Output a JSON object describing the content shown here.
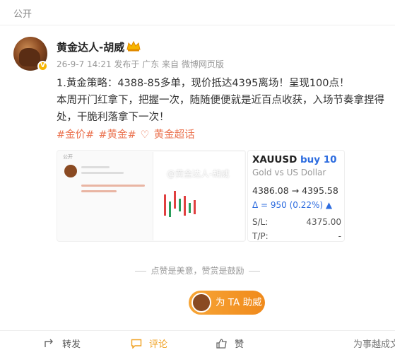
{
  "header": {
    "visibility": "公开"
  },
  "post": {
    "author": "黄金达人-胡威",
    "meta": "26-9-7 14:21  发布于 广东  来自 微博网页版",
    "lines": [
      "1.黄金策略：4388-85多单，现价抵达4395离场！呈现100点！",
      "本周开门红拿下，把握一次，随随便便就是近百点收获，入场节奏拿捏得",
      "处，干脆利落拿下一次！"
    ],
    "tags": [
      "#金价#",
      "#黄金#",
      "黄金超话"
    ]
  },
  "images": {
    "watermark": "@黄金达人-胡威",
    "trade": {
      "symbol": "XAUUSD",
      "action": "buy 10",
      "subtitle": "Gold vs US Dollar",
      "price_line": "4386.08 → 4395.58",
      "delta": "Δ = 950 (0.22%) ▲",
      "sl_label": "S/L:",
      "sl_value": "4375.00",
      "tp_label": "T/P:",
      "tp_value": "-"
    },
    "mini": {
      "public": "公开"
    }
  },
  "reward": {
    "note": "点赞是美意，赞赏是鼓励",
    "button": "为 TA 助威"
  },
  "actions": {
    "repost": "转发",
    "comment": "评论",
    "like": "赞",
    "overflow": "为事越成文"
  },
  "colors": {
    "accent": "#eb7350",
    "link": "#2d6cdf",
    "gold": "#f7b500"
  }
}
